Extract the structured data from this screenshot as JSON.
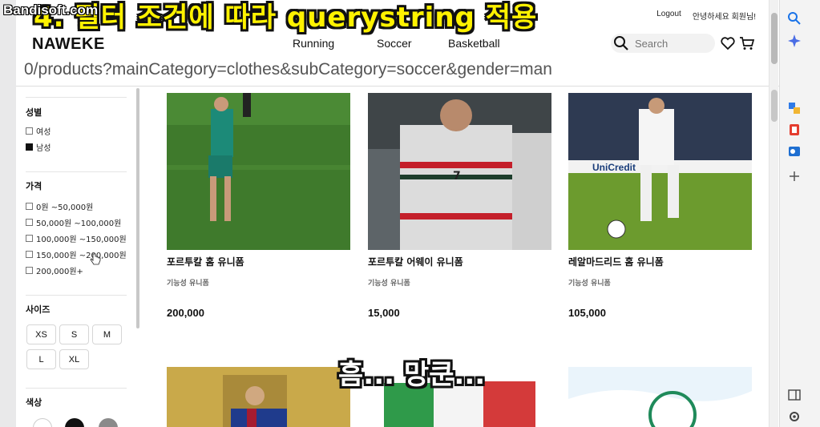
{
  "overlay": {
    "watermark": "Bandisoft.com",
    "caption_top": "4. 필터 조건에 따라 querystring 적용",
    "caption_mid": "흠... 망쿤..."
  },
  "header": {
    "logo": "NAWEKE",
    "top_links": [
      "Logout",
      "안녕하세요 회원님!"
    ],
    "nav": [
      "Running",
      "Soccer",
      "Basketball"
    ],
    "search_placeholder": "Search"
  },
  "url_bar": {
    "text": "0/products?mainCategory=clothes&subCategory=soccer&gender=man"
  },
  "filters": {
    "gender": {
      "title": "성별",
      "options": [
        {
          "label": "여성",
          "checked": false
        },
        {
          "label": "남성",
          "checked": true
        }
      ]
    },
    "price": {
      "title": "가격",
      "options": [
        {
          "label": "0원 ~50,000원",
          "checked": false
        },
        {
          "label": "50,000원 ~100,000원",
          "checked": false
        },
        {
          "label": "100,000원 ~150,000원",
          "checked": false
        },
        {
          "label": "150,000원 ~200,000원",
          "checked": false
        },
        {
          "label": "200,000원+",
          "checked": false
        }
      ]
    },
    "size": {
      "title": "사이즈",
      "options": [
        "XS",
        "S",
        "M",
        "L",
        "XL"
      ]
    },
    "color": {
      "title": "색상",
      "swatches": [
        "#ffffff",
        "#111111",
        "#8a8a8a"
      ]
    }
  },
  "products": [
    {
      "name": "포르투칼 홈 유니폼",
      "category": "기능성 유니폼",
      "price": "200,000"
    },
    {
      "name": "포르투칼 어웨이 유니폼",
      "category": "기능성 유니폼",
      "price": "15,000"
    },
    {
      "name": "레알마드리드 홈 유니폼",
      "category": "기능성 유니폼",
      "price": "105,000"
    }
  ],
  "colors": {
    "accent_yellow": "#fff200",
    "edge_blue": "#1a73e8"
  }
}
